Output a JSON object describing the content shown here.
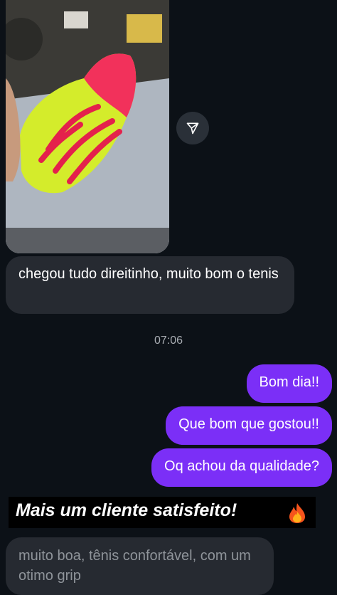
{
  "messages": {
    "incoming_1": "chegou tudo direitinho, muito bom o tenis",
    "timestamp": "07:06",
    "outgoing_1": "Bom dia!!",
    "outgoing_2": "Que bom que gostou!!",
    "outgoing_3": "Oq achou da qualidade?",
    "incoming_2": "muito boa, tênis confortável, com um otimo grip"
  },
  "overlay": {
    "caption": "Mais um cliente satisfeito!",
    "caption_emoji": "fire-emoji"
  },
  "icons": {
    "share": "send-icon"
  },
  "colors": {
    "background": "#0c1117",
    "incoming_bubble": "#262a31",
    "outgoing_bubble": "#7b2ff7",
    "timestamp": "#a9adb3"
  }
}
